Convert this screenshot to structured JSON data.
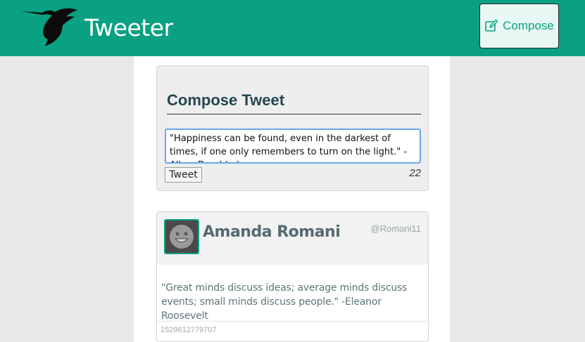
{
  "navbar": {
    "logo_icon": "hummingbird-icon",
    "brand": "Tweeter",
    "compose_button": {
      "icon": "edit-icon",
      "label": "Compose"
    }
  },
  "compose": {
    "title": "Compose Tweet",
    "text_value": "\"Happiness can be found, even in the darkest of times, if one only remembers to turn on the light.\" - Albus Dumbledore",
    "submit_label": "Tweet",
    "counter": "22"
  },
  "tweets": [
    {
      "avatar_icon": "smiley-avatar-icon",
      "name": "Amanda Romani",
      "handle": "@Romani11",
      "content": "\"Great minds discuss ideas; average minds discuss events; small minds discuss people.\" -Eleanor Roosevelt",
      "timestamp": "1529612779707"
    }
  ],
  "colors": {
    "accent": "#0aa182",
    "header_text": "#244751",
    "name_text": "#556b70",
    "page_bg": "#e8e8e8"
  }
}
